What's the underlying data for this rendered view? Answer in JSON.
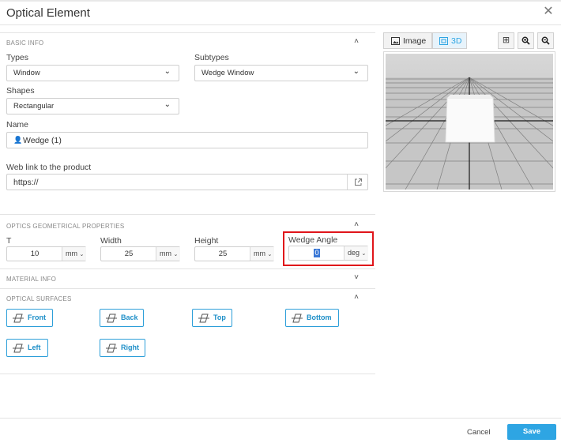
{
  "dialog": {
    "title": "Optical Element",
    "close_icon": "close-icon"
  },
  "basic_info": {
    "section_label": "BASIC INFO",
    "types_label": "Types",
    "types_value": "Window",
    "subtypes_label": "Subtypes",
    "subtypes_value": "Wedge Window",
    "shapes_label": "Shapes",
    "shapes_value": "Rectangular",
    "name_label": "Name",
    "name_value": "Wedge (1)",
    "weblink_label": "Web link to the product",
    "weblink_value": "https://"
  },
  "geom": {
    "section_label": "OPTICS GEOMETRICAL PROPERTIES",
    "fields": [
      {
        "label": "T",
        "value": "10",
        "unit": "mm"
      },
      {
        "label": "Width",
        "value": "25",
        "unit": "mm"
      },
      {
        "label": "Height",
        "value": "25",
        "unit": "mm"
      },
      {
        "label": "Wedge Angle",
        "value": "0",
        "unit": "deg"
      }
    ]
  },
  "material": {
    "section_label": "MATERIAL INFO"
  },
  "surfaces": {
    "section_label": "OPTICAL SURFACES",
    "buttons": [
      "Front",
      "Back",
      "Top",
      "Bottom",
      "Left",
      "Right"
    ]
  },
  "preview": {
    "tab_image": "Image",
    "tab_3d": "3D",
    "active_tab": "3D"
  },
  "footer": {
    "cancel": "Cancel",
    "save": "Save"
  },
  "colors": {
    "accent": "#2ea5e3",
    "highlight": "#e0151a"
  }
}
